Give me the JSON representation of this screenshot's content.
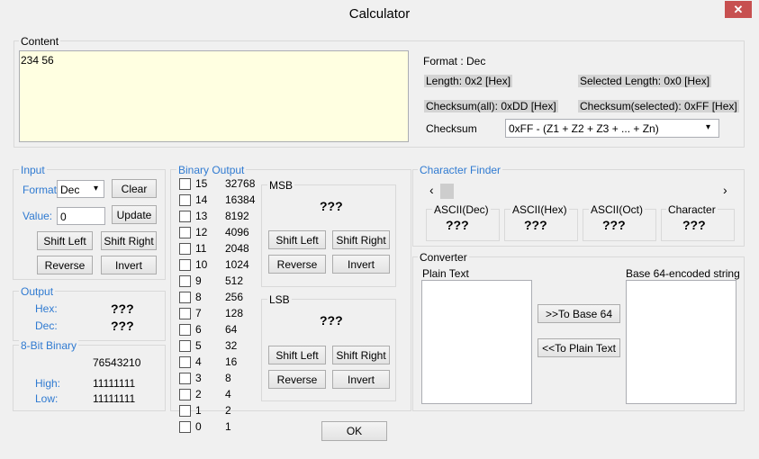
{
  "window": {
    "title": "Calculator",
    "close_glyph": "✕"
  },
  "content": {
    "group_label": "Content",
    "text_value": "234 56",
    "format": "Format : Dec",
    "length": "Length:  0x2 [Hex]",
    "selected_length": "Selected Length:  0x0 [Hex]",
    "checksum_all": "Checksum(all):  0xDD [Hex]",
    "checksum_selected": "Checksum(selected):  0xFF [Hex]",
    "checksum_label": "Checksum",
    "checksum_value": "0xFF - (Z1 + Z2 + Z3 + ... + Zn)"
  },
  "input": {
    "group_label": "Input",
    "format_label": "Format:",
    "format_value": "Dec",
    "clear": "Clear",
    "value_label": "Value:",
    "value": "0",
    "update": "Update",
    "shift_left": "Shift Left",
    "shift_right": "Shift Right",
    "reverse": "Reverse",
    "invert": "Invert"
  },
  "output": {
    "group_label": "Output",
    "hex_label": "Hex:",
    "hex_value": "???",
    "dec_label": "Dec:",
    "dec_value": "???"
  },
  "binary8": {
    "group_label": "8-Bit Binary",
    "digits": "76543210",
    "high_label": "High:",
    "high_value": "11111111",
    "low_label": "Low:",
    "low_value": "11111111"
  },
  "binary_output": {
    "group_label": "Binary Output",
    "bits": [
      {
        "bit": "15",
        "value": "32768"
      },
      {
        "bit": "14",
        "value": "16384"
      },
      {
        "bit": "13",
        "value": "8192"
      },
      {
        "bit": "12",
        "value": "4096"
      },
      {
        "bit": "11",
        "value": "2048"
      },
      {
        "bit": "10",
        "value": "1024"
      },
      {
        "bit": "9",
        "value": "512"
      },
      {
        "bit": "8",
        "value": "256"
      },
      {
        "bit": "7",
        "value": "128"
      },
      {
        "bit": "6",
        "value": "64"
      },
      {
        "bit": "5",
        "value": "32"
      },
      {
        "bit": "4",
        "value": "16"
      },
      {
        "bit": "3",
        "value": "8"
      },
      {
        "bit": "2",
        "value": "4"
      },
      {
        "bit": "1",
        "value": "2"
      },
      {
        "bit": "0",
        "value": "1"
      }
    ],
    "msb": {
      "label": "MSB",
      "value": "???",
      "shift_left": "Shift Left",
      "shift_right": "Shift Right",
      "reverse": "Reverse",
      "invert": "Invert"
    },
    "lsb": {
      "label": "LSB",
      "value": "???",
      "shift_left": "Shift Left",
      "shift_right": "Shift Right",
      "reverse": "Reverse",
      "invert": "Invert"
    }
  },
  "char_finder": {
    "group_label": "Character Finder",
    "left_arrow": "‹",
    "right_arrow": "›",
    "ascii_dec_label": "ASCII(Dec)",
    "ascii_dec_value": "???",
    "ascii_hex_label": "ASCII(Hex)",
    "ascii_hex_value": "???",
    "ascii_oct_label": "ASCII(Oct)",
    "ascii_oct_value": "???",
    "character_label": "Character",
    "character_value": "???"
  },
  "converter": {
    "group_label": "Converter",
    "plain_label": "Plain Text",
    "base64_label": "Base 64-encoded string",
    "to_base64": ">>To Base 64",
    "to_plain": "<<To Plain Text"
  },
  "ok": "OK"
}
